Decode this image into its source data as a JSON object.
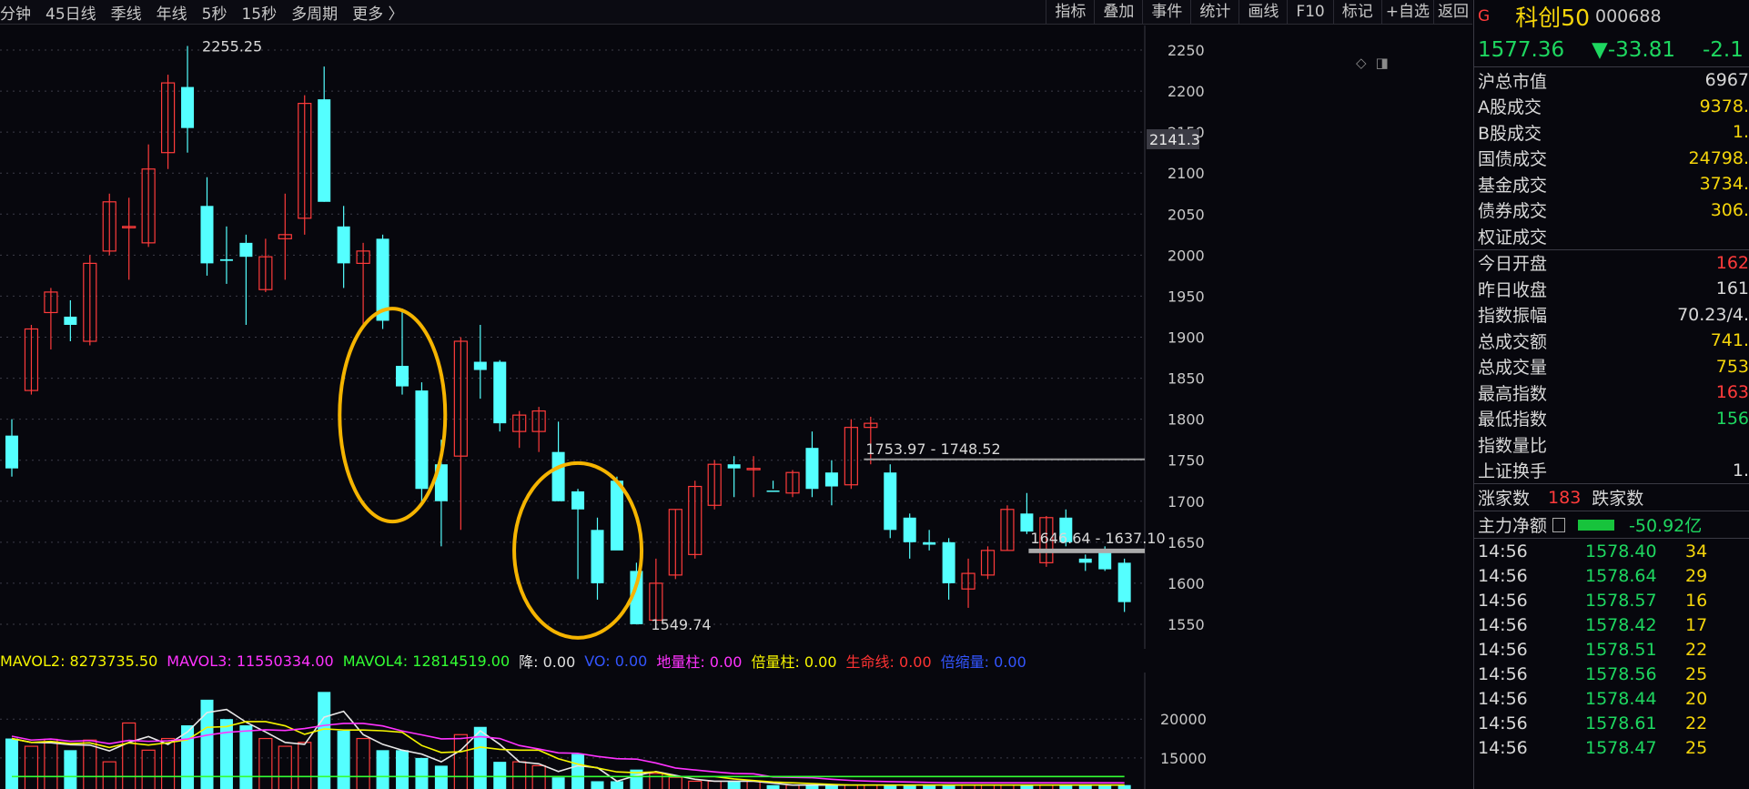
{
  "toolbar": {
    "periods": [
      "分钟",
      "45日线",
      "季线",
      "年线",
      "5秒",
      "15秒",
      "多周期",
      "更多 〉"
    ],
    "tools": [
      "指标",
      "叠加",
      "事件",
      "统计",
      "画线",
      "F10",
      "标记",
      "+自选",
      "返回"
    ]
  },
  "chart_icons": [
    "diamond-icon",
    "panel-toggle-icon"
  ],
  "colors": {
    "up": "#ff3b3b",
    "down": "#54ffff",
    "annotation": "#f5b400",
    "background": "#07070d"
  },
  "chart_data": {
    "type": "candlestick",
    "y_ticks": [
      2250,
      2200,
      2150,
      2100,
      2050,
      2000,
      1950,
      1900,
      1850,
      1800,
      1750,
      1700,
      1650,
      1600,
      1550
    ],
    "ylim": [
      1520,
      2280
    ],
    "crosshair_price_label": "2141.3",
    "high_label": "2255.25",
    "low_label": "1549.74",
    "range_label_1": "1753.97 - 1748.52",
    "range_label_2": "1646.64 - 1637.10",
    "candles": [
      {
        "o": 1780,
        "h": 1800,
        "l": 1730,
        "c": 1740
      },
      {
        "o": 1835,
        "h": 1915,
        "l": 1830,
        "c": 1910
      },
      {
        "o": 1930,
        "h": 1960,
        "l": 1885,
        "c": 1955
      },
      {
        "o": 1925,
        "h": 1945,
        "l": 1895,
        "c": 1915
      },
      {
        "o": 1895,
        "h": 2000,
        "l": 1890,
        "c": 1990
      },
      {
        "o": 2005,
        "h": 2075,
        "l": 2000,
        "c": 2065
      },
      {
        "o": 2035,
        "h": 2070,
        "l": 1970,
        "c": 2035
      },
      {
        "o": 2015,
        "h": 2135,
        "l": 2010,
        "c": 2105
      },
      {
        "o": 2125,
        "h": 2220,
        "l": 2105,
        "c": 2210
      },
      {
        "o": 2205,
        "h": 2255,
        "l": 2125,
        "c": 2155
      },
      {
        "o": 2060,
        "h": 2095,
        "l": 1975,
        "c": 1990
      },
      {
        "o": 1995,
        "h": 2035,
        "l": 1965,
        "c": 1993
      },
      {
        "o": 2015,
        "h": 2025,
        "l": 1915,
        "c": 1998
      },
      {
        "o": 1958,
        "h": 2020,
        "l": 1955,
        "c": 1998
      },
      {
        "o": 2020,
        "h": 2075,
        "l": 1970,
        "c": 2025
      },
      {
        "o": 2045,
        "h": 2195,
        "l": 2025,
        "c": 2185
      },
      {
        "o": 2190,
        "h": 2230,
        "l": 2065,
        "c": 2065
      },
      {
        "o": 2035,
        "h": 2060,
        "l": 1960,
        "c": 1990
      },
      {
        "o": 1990,
        "h": 2015,
        "l": 1915,
        "c": 2005
      },
      {
        "o": 2020,
        "h": 2025,
        "l": 1910,
        "c": 1920
      },
      {
        "o": 1865,
        "h": 1935,
        "l": 1830,
        "c": 1840
      },
      {
        "o": 1835,
        "h": 1845,
        "l": 1700,
        "c": 1715
      },
      {
        "o": 1745,
        "h": 1775,
        "l": 1645,
        "c": 1700
      },
      {
        "o": 1755,
        "h": 1900,
        "l": 1665,
        "c": 1895
      },
      {
        "o": 1870,
        "h": 1915,
        "l": 1825,
        "c": 1860
      },
      {
        "o": 1870,
        "h": 1872,
        "l": 1785,
        "c": 1795
      },
      {
        "o": 1785,
        "h": 1810,
        "l": 1765,
        "c": 1805
      },
      {
        "o": 1785,
        "h": 1815,
        "l": 1760,
        "c": 1810
      },
      {
        "o": 1760,
        "h": 1797,
        "l": 1700,
        "c": 1700
      },
      {
        "o": 1712,
        "h": 1715,
        "l": 1605,
        "c": 1690
      },
      {
        "o": 1665,
        "h": 1680,
        "l": 1580,
        "c": 1600
      },
      {
        "o": 1725,
        "h": 1730,
        "l": 1665,
        "c": 1640
      },
      {
        "o": 1615,
        "h": 1625,
        "l": 1549.74,
        "c": 1550
      },
      {
        "o": 1555,
        "h": 1630,
        "l": 1550,
        "c": 1600
      },
      {
        "o": 1610,
        "h": 1690,
        "l": 1605,
        "c": 1690
      },
      {
        "o": 1635,
        "h": 1725,
        "l": 1630,
        "c": 1718
      },
      {
        "o": 1695,
        "h": 1750,
        "l": 1690,
        "c": 1745
      },
      {
        "o": 1745,
        "h": 1755,
        "l": 1705,
        "c": 1740
      },
      {
        "o": 1740,
        "h": 1755,
        "l": 1705,
        "c": 1740
      },
      {
        "o": 1713,
        "h": 1725,
        "l": 1715,
        "c": 1712
      },
      {
        "o": 1710,
        "h": 1738,
        "l": 1705,
        "c": 1735
      },
      {
        "o": 1765,
        "h": 1785,
        "l": 1705,
        "c": 1715
      },
      {
        "o": 1735,
        "h": 1750,
        "l": 1695,
        "c": 1718
      },
      {
        "o": 1720,
        "h": 1800,
        "l": 1715,
        "c": 1790
      },
      {
        "o": 1790,
        "h": 1803,
        "l": 1745,
        "c": 1795
      },
      {
        "o": 1735,
        "h": 1745,
        "l": 1655,
        "c": 1665
      },
      {
        "o": 1680,
        "h": 1685,
        "l": 1630,
        "c": 1650
      },
      {
        "o": 1650,
        "h": 1665,
        "l": 1640,
        "c": 1647
      },
      {
        "o": 1650,
        "h": 1655,
        "l": 1580,
        "c": 1600
      },
      {
        "o": 1593,
        "h": 1630,
        "l": 1570,
        "c": 1612
      },
      {
        "o": 1610,
        "h": 1645,
        "l": 1605,
        "c": 1640
      },
      {
        "o": 1640,
        "h": 1695,
        "l": 1640,
        "c": 1690
      },
      {
        "o": 1685,
        "h": 1710,
        "l": 1660,
        "c": 1663
      },
      {
        "o": 1625,
        "h": 1682,
        "l": 1620,
        "c": 1680
      },
      {
        "o": 1680,
        "h": 1690,
        "l": 1645,
        "c": 1650
      },
      {
        "o": 1630,
        "h": 1635,
        "l": 1615,
        "c": 1625
      },
      {
        "o": 1640,
        "h": 1645,
        "l": 1615,
        "c": 1617
      },
      {
        "o": 1625,
        "h": 1630,
        "l": 1565,
        "c": 1577
      }
    ],
    "volume": {
      "y_ticks": [
        "20000",
        "15000"
      ],
      "ylim": [
        11000,
        26000
      ],
      "bars": [
        17500,
        16500,
        17400,
        16000,
        17300,
        14500,
        19500,
        16000,
        17500,
        19200,
        22500,
        20000,
        19200,
        17500,
        16500,
        17000,
        23500,
        18500,
        17500,
        16000,
        16000,
        15000,
        14000,
        18000,
        19000,
        14500,
        14500,
        14000,
        12500,
        15500,
        12000,
        12000,
        13500,
        13000,
        12500,
        12000,
        12000,
        12000,
        12000,
        11500,
        11500,
        11500,
        11500,
        11500,
        11500,
        11500,
        11500,
        11500,
        11500,
        11500,
        11500,
        11500,
        11500,
        11500,
        11500,
        11500,
        11500,
        11500
      ]
    },
    "mavol_legend": [
      {
        "label": "MAVOL2: 8273735.50",
        "color": "#f5f500"
      },
      {
        "label": "MAVOL3: 11550334.00",
        "color": "#ff33ff"
      },
      {
        "label": "MAVOL4: 12814519.00",
        "color": "#33ff33"
      },
      {
        "label": "降: 0.00",
        "color": "#e0e0e0"
      },
      {
        "label": "VO: 0.00",
        "color": "#3355ff"
      },
      {
        "label": "地量柱: 0.00",
        "color": "#ff33ff"
      },
      {
        "label": "倍量柱: 0.00",
        "color": "#f5f500"
      },
      {
        "label": "生命线: 0.00",
        "color": "#ff3333"
      },
      {
        "label": "倍缩量: 0.00",
        "color": "#3355ff"
      }
    ]
  },
  "panel": {
    "market_flag": "G",
    "name": "科创50",
    "code": "000688",
    "price": "1577.36",
    "change": "▼-33.81",
    "change_pct": "-2.1",
    "stats_a": [
      {
        "k": "沪总市值",
        "v": "6967",
        "c": "#d8d8d8"
      },
      {
        "k": "A股成交",
        "v": "9378.",
        "c": "#f5d50b"
      },
      {
        "k": "B股成交",
        "v": "1.",
        "c": "#f5d50b"
      },
      {
        "k": "国债成交",
        "v": "24798.",
        "c": "#f5d50b"
      },
      {
        "k": "基金成交",
        "v": "3734.",
        "c": "#f5d50b"
      },
      {
        "k": "债券成交",
        "v": "306.",
        "c": "#f5d50b"
      },
      {
        "k": "权证成交",
        "v": "",
        "c": "#f5d50b"
      }
    ],
    "stats_b": [
      {
        "k": "今日开盘",
        "v": "162",
        "c": "#ff3b3b"
      },
      {
        "k": "昨日收盘",
        "v": "161",
        "c": "#d8d8d8"
      },
      {
        "k": "指数振幅",
        "v": "70.23/4.",
        "c": "#d8d8d8"
      },
      {
        "k": "总成交额",
        "v": "741.",
        "c": "#f5d50b"
      },
      {
        "k": "总成交量",
        "v": "753",
        "c": "#f5d50b"
      },
      {
        "k": "最高指数",
        "v": "163",
        "c": "#ff3b3b"
      },
      {
        "k": "最低指数",
        "v": "156",
        "c": "#1ed760"
      },
      {
        "k": "指数量比",
        "v": "",
        "c": "#d8d8d8"
      },
      {
        "k": "上证换手",
        "v": "1.",
        "c": "#d8d8d8"
      }
    ],
    "rise_label": "涨家数",
    "rise_count": "183",
    "fall_label": "跌家数",
    "flow_label": "主力净额",
    "flow_value": "-50.92亿",
    "ticks": [
      {
        "t": "14:56",
        "p": "1578.40",
        "v": "34"
      },
      {
        "t": "14:56",
        "p": "1578.64",
        "v": "29"
      },
      {
        "t": "14:56",
        "p": "1578.57",
        "v": "16"
      },
      {
        "t": "14:56",
        "p": "1578.42",
        "v": "17"
      },
      {
        "t": "14:56",
        "p": "1578.51",
        "v": "22"
      },
      {
        "t": "14:56",
        "p": "1578.56",
        "v": "25"
      },
      {
        "t": "14:56",
        "p": "1578.44",
        "v": "20"
      },
      {
        "t": "14:56",
        "p": "1578.61",
        "v": "22"
      },
      {
        "t": "14:56",
        "p": "1578.47",
        "v": "25"
      }
    ]
  }
}
